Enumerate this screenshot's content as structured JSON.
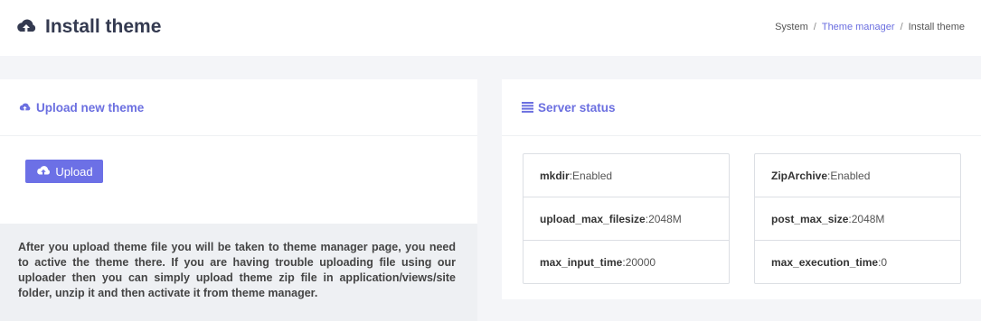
{
  "header": {
    "title": "Install theme",
    "title_icon": "cloud-upload-icon"
  },
  "breadcrumb": {
    "items": [
      "System",
      "Theme manager",
      "Install theme"
    ],
    "separator": "/"
  },
  "upload_card": {
    "title": "Upload new theme",
    "title_icon": "cloud-upload-icon",
    "button_label": "Upload",
    "note": "After you upload theme file you will be taken to theme manager page, you need to active the theme there. If you are having trouble uploading file using our uploader then you can simply upload theme zip file in application/views/site folder, unzip it and then activate it from theme manager."
  },
  "server_card": {
    "title": "Server status",
    "title_icon": "list-icon",
    "left": [
      {
        "key": "mkdir",
        "sep": " : ",
        "value": "Enabled"
      },
      {
        "key": "upload_max_filesize",
        "sep": " : ",
        "value": "2048M"
      },
      {
        "key": "max_input_time",
        "sep": " : ",
        "value": "20000"
      }
    ],
    "right": [
      {
        "key": "ZipArchive",
        "sep": " : ",
        "value": "Enabled"
      },
      {
        "key": "post_max_size",
        "sep": " : ",
        "value": "2048M"
      },
      {
        "key": "max_execution_time",
        "sep": " : ",
        "value": "0"
      }
    ]
  },
  "colors": {
    "accent": "#6b6fe0",
    "button": "#6c70e6",
    "title": "#343a50"
  }
}
